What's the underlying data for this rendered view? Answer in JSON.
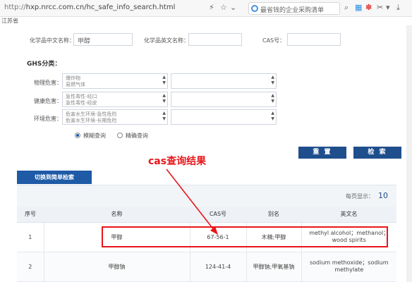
{
  "browser": {
    "url_scheme": "http://",
    "url": "hxp.nrcc.com.cn/hc_safe_info_search.html",
    "search_text": "最省钱的企业采购清单",
    "tab_label": "江苏省"
  },
  "form": {
    "cn_name_label": "化学品中文名称：",
    "cn_name_value": "甲醇",
    "en_name_label": "化学品英文名称：",
    "en_name_value": "",
    "cas_label": "CAS号：",
    "cas_value": "",
    "ghs_title": "GHS分类：",
    "physical_label": "物理危害：",
    "physical_options": [
      "爆炸物",
      "易燃气体"
    ],
    "health_label": "健康危害：",
    "health_options": [
      "急性毒性-经口",
      "急性毒性-经皮"
    ],
    "env_label": "环境危害：",
    "env_options": [
      "危害水生环境-急性危险",
      "危害水生环境-长期危险"
    ],
    "fuzzy_label": "模糊查询",
    "exact_label": "精确查询",
    "reset_label": "重 置",
    "search_label": "检 索"
  },
  "switch_label": "切换到简单检索",
  "results": {
    "per_page_label": "每页显示：",
    "per_page_value": "10",
    "headers": [
      "序号",
      "名称",
      "CAS号",
      "别名",
      "英文名"
    ],
    "rows": [
      {
        "no": "1",
        "name": "甲醇",
        "cas": "67-56-1",
        "alias": "木精;甲醇",
        "en": "methyl alcohol；methanol；wood spirits"
      },
      {
        "no": "2",
        "name": "甲醇钠",
        "cas": "124-41-4",
        "alias": "甲醇钠;甲氧基钠",
        "en": "sodium methoxide；sodium methylate"
      }
    ]
  },
  "annotation": {
    "text": "cas查询结果",
    "color": "#e8161b"
  }
}
